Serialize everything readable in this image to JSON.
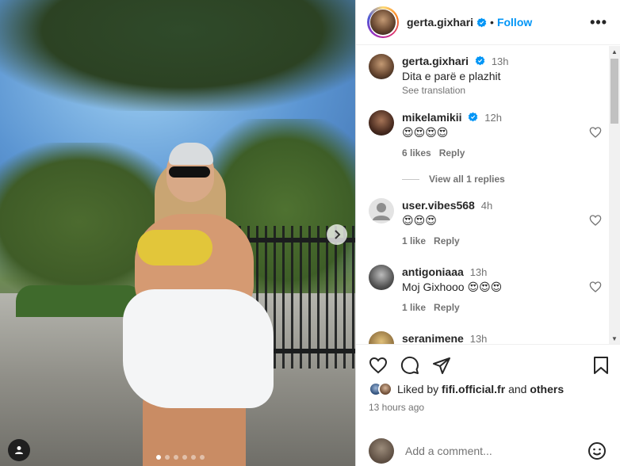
{
  "post": {
    "author": "gerta.gixhari",
    "follow_label": "Follow",
    "separator": "•",
    "more_label": "•••"
  },
  "caption": {
    "user": "gerta.gixhari",
    "time": "13h",
    "text": "Dita e parë e plazhit",
    "see_translation": "See translation"
  },
  "comments": [
    {
      "user": "mikelamikii",
      "verified": true,
      "time": "12h",
      "text": "😍😍😍😍",
      "likes": "6 likes",
      "reply": "Reply"
    },
    {
      "user": "user.vibes568",
      "verified": false,
      "time": "4h",
      "text": "😍😍😍",
      "likes": "1 like",
      "reply": "Reply"
    },
    {
      "user": "antigoniaaa",
      "verified": false,
      "time": "13h",
      "text": "Moj Gixhooo 😍😍😍",
      "likes": "1 like",
      "reply": "Reply"
    },
    {
      "user": "seranimene",
      "verified": false,
      "time": "13h",
      "text": "",
      "likes": "",
      "reply": ""
    }
  ],
  "view_replies": "View all 1 replies",
  "liked_by": {
    "prefix": "Liked by",
    "user": "fifi.official.fr",
    "and": "and",
    "others": "others"
  },
  "time_ago": "13 hours ago",
  "add_comment": {
    "placeholder": "Add a comment..."
  },
  "carousel": {
    "count": 6,
    "active_index": 0
  },
  "icons": {
    "verified": "verified-badge-icon",
    "heart": "heart-icon",
    "comment": "comment-icon",
    "share": "share-icon",
    "save": "bookmark-icon",
    "emoji": "emoji-icon",
    "next": "chevron-right-icon",
    "tag": "user-tag-icon"
  },
  "colors": {
    "accent": "#0095f6",
    "verified": "#0095f6"
  }
}
